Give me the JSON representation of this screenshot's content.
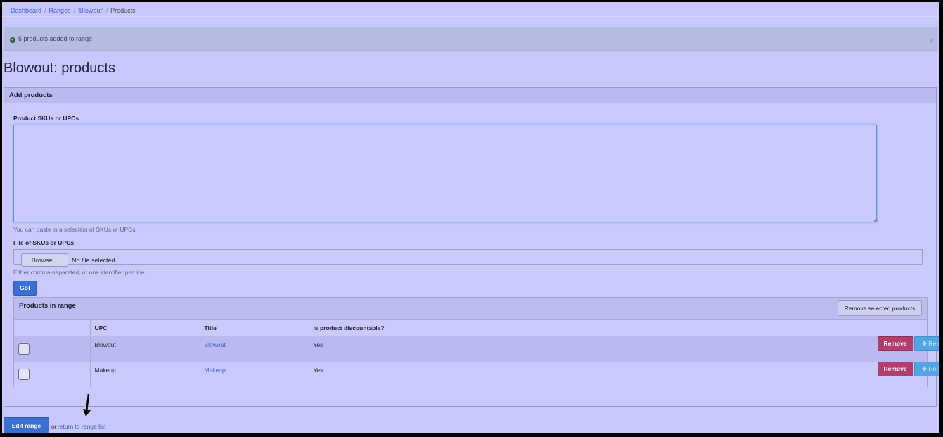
{
  "breadcrumb": {
    "items": [
      "Dashboard",
      "Ranges",
      "'Blowout'"
    ],
    "active": "Products"
  },
  "alert": {
    "message": "5 products added to range",
    "close": "×",
    "icon": "check-circle-icon"
  },
  "page_title": "Blowout: products",
  "add_products": {
    "heading": "Add products",
    "sku_label": "Product SKUs or UPCs",
    "sku_value": "",
    "sku_help": "You can paste in a selection of SKUs or UPCs",
    "file_label": "File of SKUs or UPCs",
    "browse_label": "Browse...",
    "no_file": "No file selected.",
    "file_help": "Either comma-separated, or one identifier per line",
    "go_label": "Go!"
  },
  "range": {
    "heading": "Products in range",
    "remove_selected": "Remove selected products",
    "columns": [
      "",
      "UPC",
      "Title",
      "Is product discountable?",
      ""
    ],
    "rows": [
      {
        "upc": "Blowout",
        "title": "Blowout",
        "discountable": "Yes"
      },
      {
        "upc": "Makeup",
        "title": "Makeup",
        "discountable": "Yes"
      }
    ],
    "remove_label": "Remove",
    "reorder_label": "Re-order"
  },
  "footer": {
    "edit_label": "Edit range",
    "or": "or",
    "return_link": "return to range list"
  }
}
